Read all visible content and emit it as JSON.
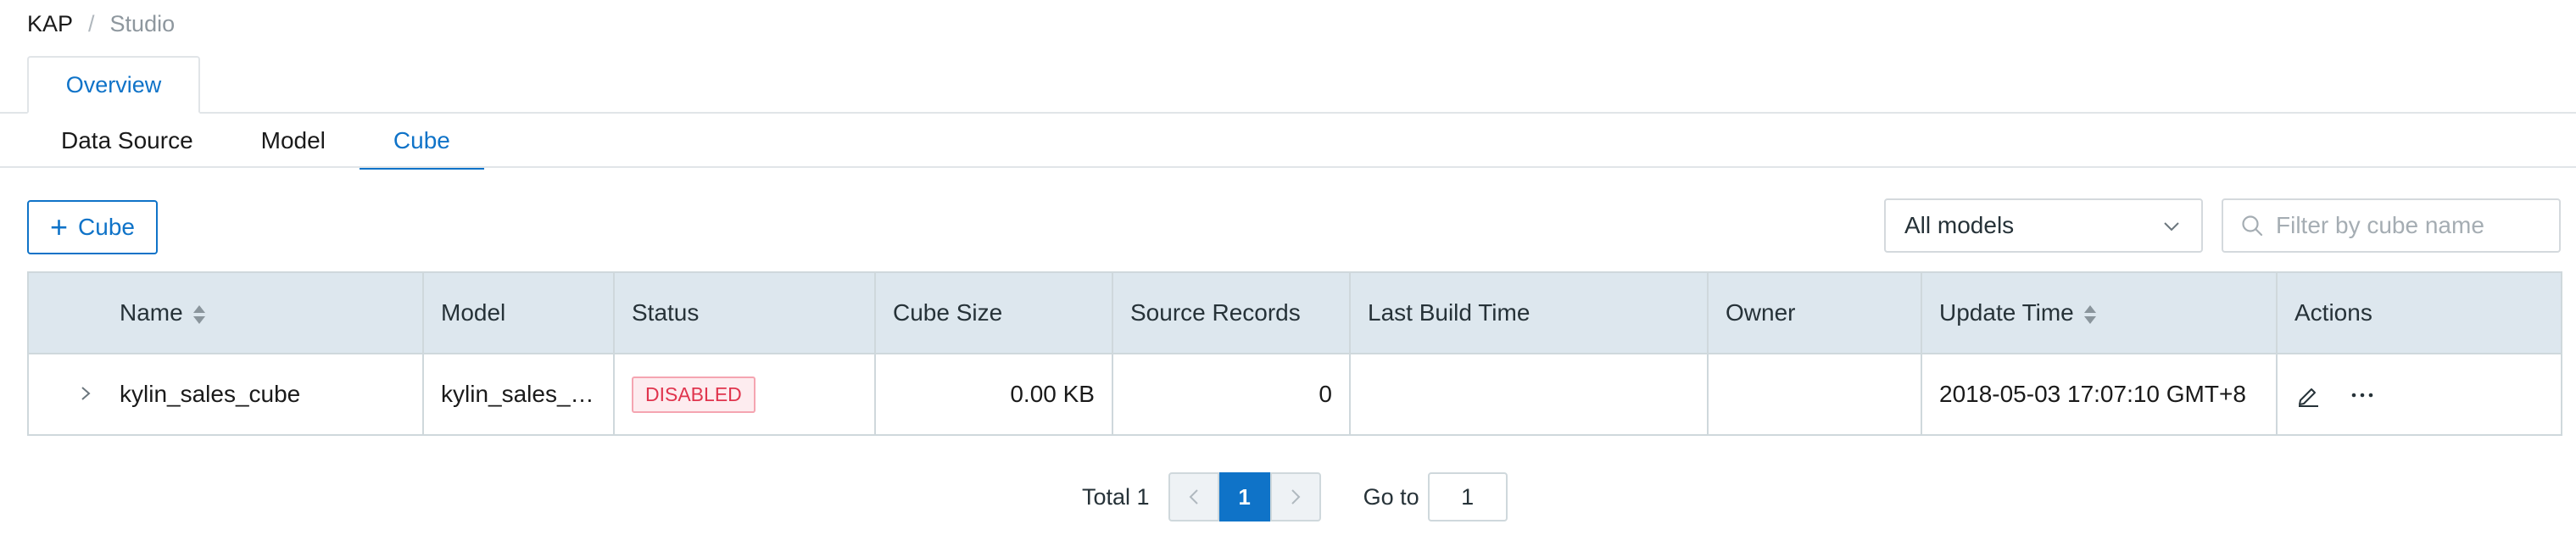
{
  "breadcrumb": {
    "root": "KAP",
    "separator": "/",
    "current": "Studio"
  },
  "overview_tab": {
    "label": "Overview"
  },
  "subtabs": [
    {
      "label": "Data Source"
    },
    {
      "label": "Model"
    },
    {
      "label": "Cube",
      "active": true
    }
  ],
  "toolbar": {
    "add_cube_label": "Cube",
    "model_select_value": "All models",
    "search_placeholder": "Filter by cube name"
  },
  "table": {
    "headers": {
      "name": "Name",
      "model": "Model",
      "status": "Status",
      "cube_size": "Cube Size",
      "source_records": "Source Records",
      "last_build_time": "Last Build Time",
      "owner": "Owner",
      "update_time": "Update Time",
      "actions": "Actions"
    },
    "rows": [
      {
        "name": "kylin_sales_cube",
        "model": "kylin_sales_model",
        "status": "DISABLED",
        "cube_size": "0.00 KB",
        "source_records": "0",
        "last_build_time": "",
        "owner": "",
        "update_time": "2018-05-03 17:07:10 GMT+8"
      }
    ]
  },
  "pagination": {
    "total_label": "Total 1",
    "current_page": "1",
    "goto_label": "Go to",
    "goto_value": "1"
  },
  "colors": {
    "accent": "#0f73c8",
    "header_bg": "#dde7ee",
    "status_disabled": "#e0344d"
  },
  "icons": {
    "select_chevron": "chevron-down-icon",
    "search": "search-icon",
    "expand": "chevron-right-icon",
    "edit": "pencil-icon",
    "more": "more-icon",
    "prev": "chevron-left-icon",
    "next": "chevron-right-icon"
  }
}
